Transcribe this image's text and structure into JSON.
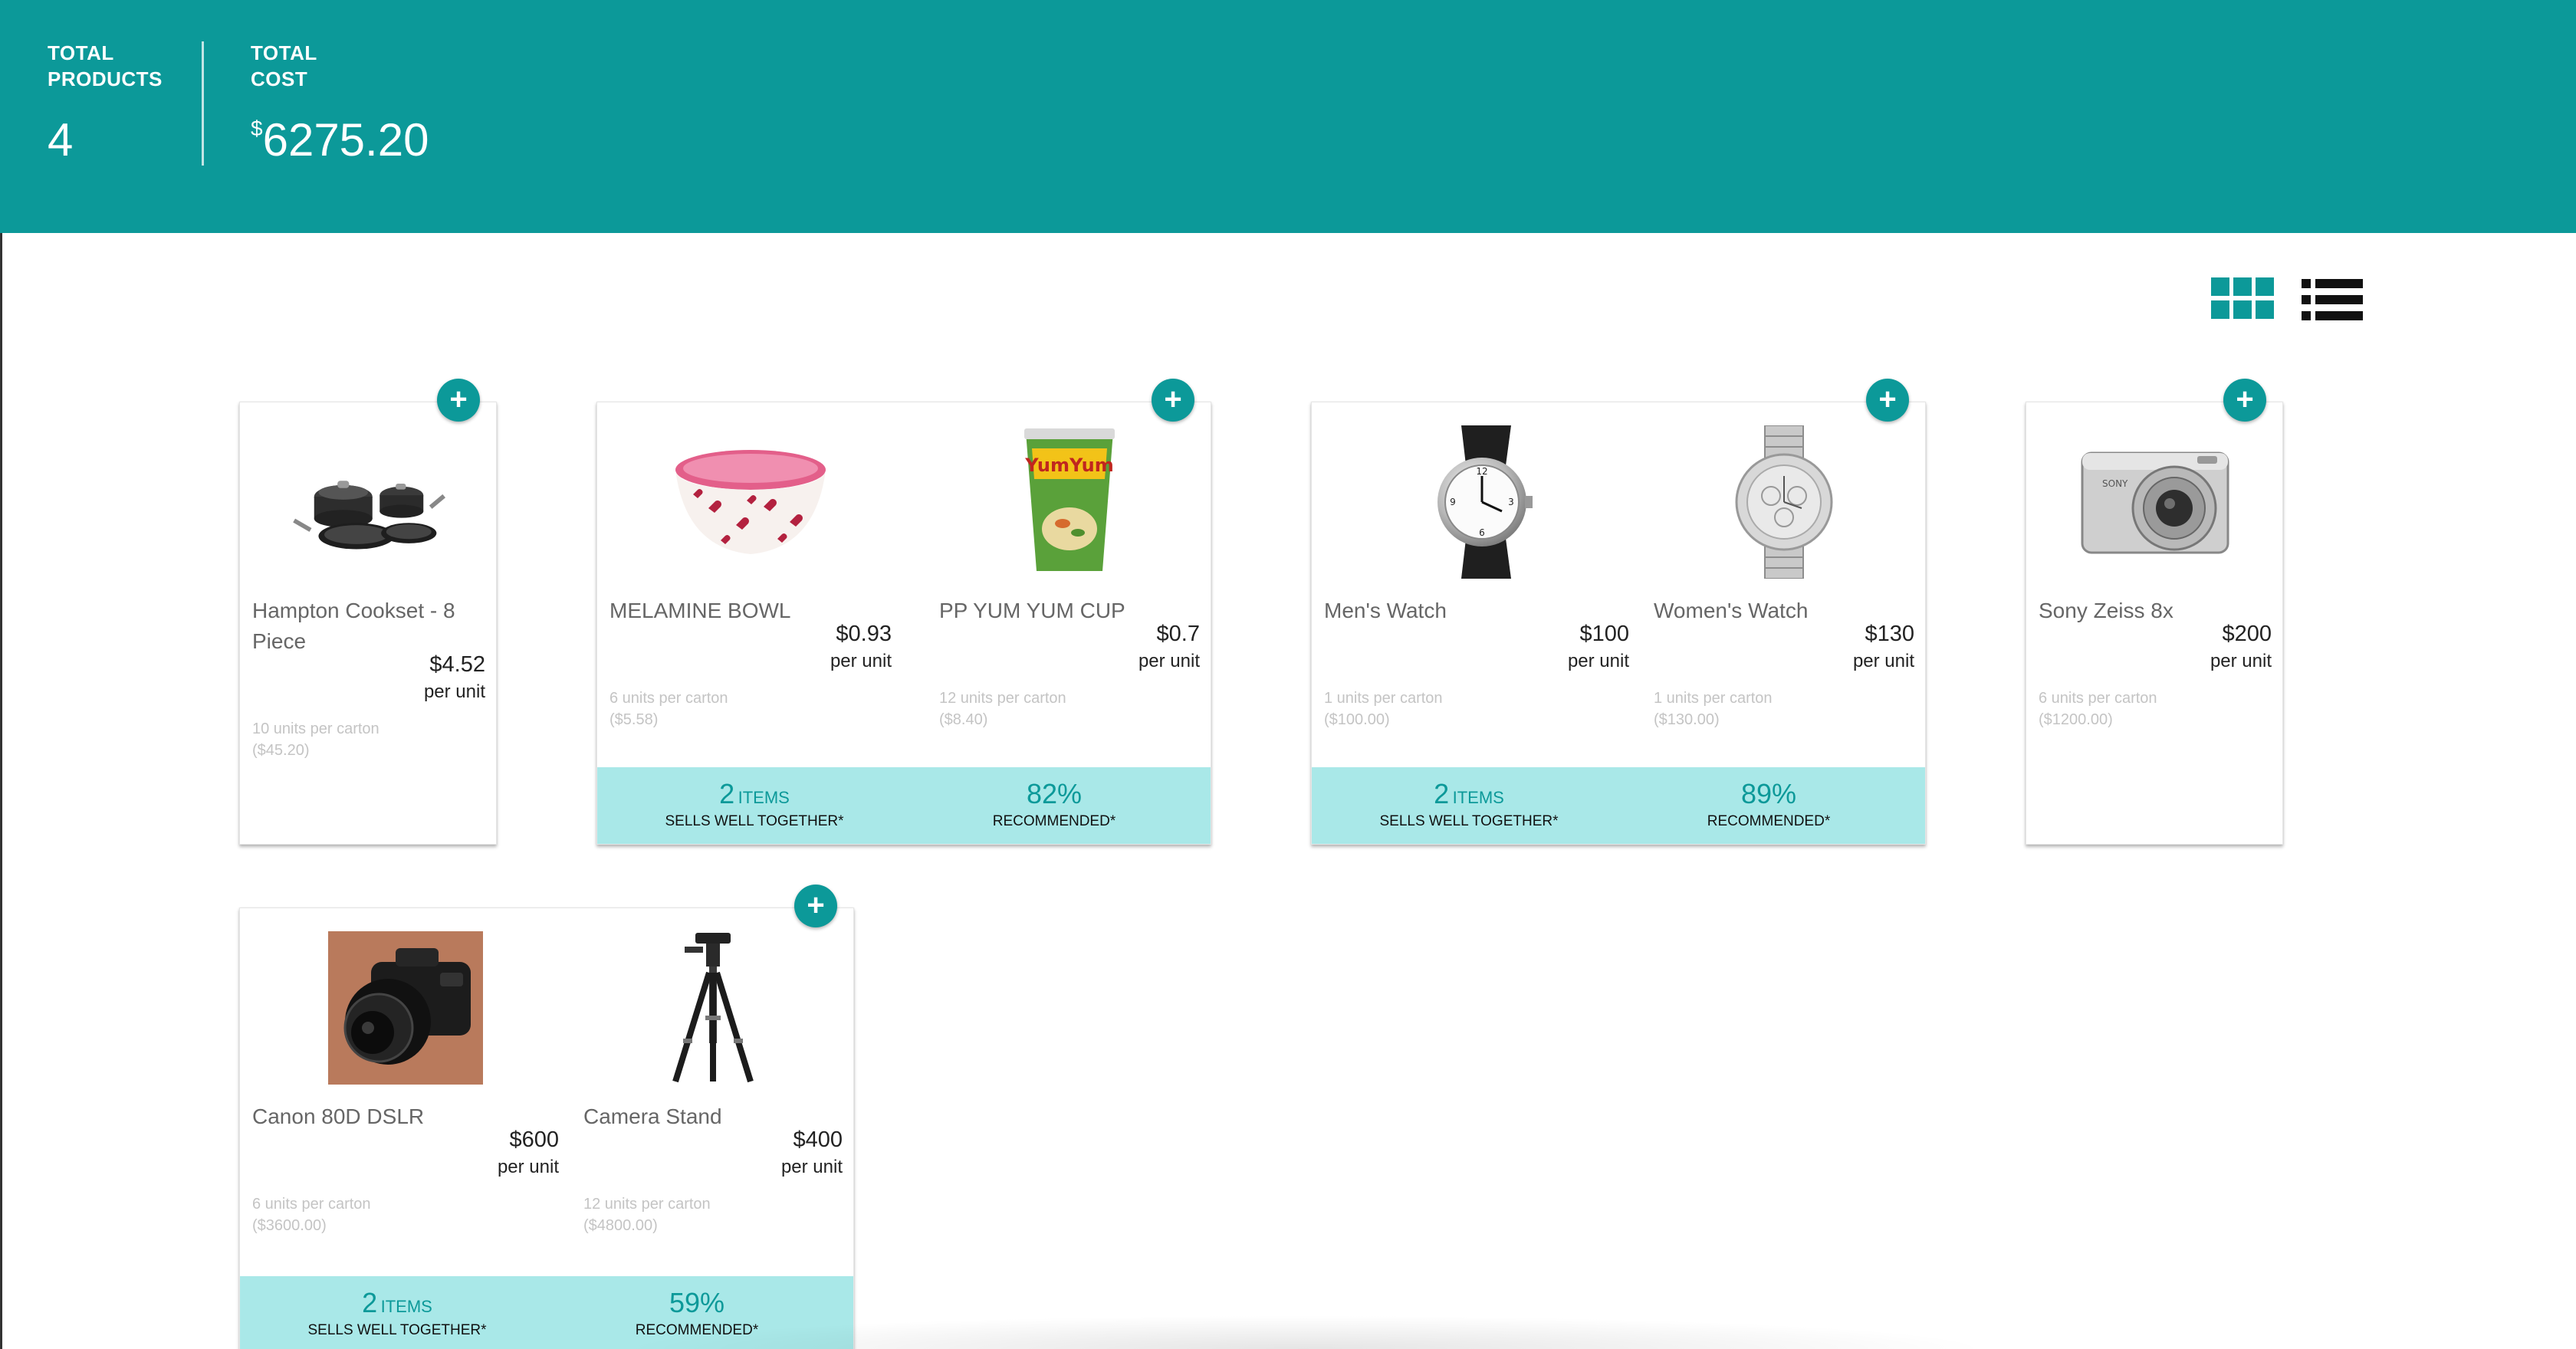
{
  "summary": {
    "total_products": {
      "label_line1": "TOTAL",
      "label_line2": "PRODUCTS",
      "value": "4"
    },
    "total_cost": {
      "label_line1": "TOTAL",
      "label_line2": "COST",
      "currency": "$",
      "value": "6275.20"
    }
  },
  "view_toggles": {
    "grid_icon": "grid-view-icon",
    "list_icon": "list-view-icon",
    "active": "grid"
  },
  "add_button_label": "+",
  "colors": {
    "accent": "#0c9999",
    "strip": "#a9e8e8"
  },
  "groups": [
    {
      "products": [
        {
          "name": "Hampton Cookset - 8 Piece",
          "price": "$4.52",
          "unit": "per unit",
          "carton": "10 units per carton",
          "carton_price": "($45.20)",
          "image": "cookset"
        }
      ]
    },
    {
      "products": [
        {
          "name": "MELAMINE BOWL",
          "price": "$0.93",
          "unit": "per unit",
          "carton": "6 units per carton",
          "carton_price": "($5.58)",
          "image": "bowl"
        },
        {
          "name": "PP YUM YUM CUP",
          "price": "$0.7",
          "unit": "per unit",
          "carton": "12 units per carton",
          "carton_price": "($8.40)",
          "image": "noodle-cup"
        }
      ],
      "strip": {
        "items_count": "2",
        "items_label": "ITEMS",
        "items_caption": "SELLS WELL TOGETHER*",
        "percent": "82%",
        "percent_caption": "RECOMMENDED*"
      }
    },
    {
      "products": [
        {
          "name": "Men's Watch",
          "price": "$100",
          "unit": "per unit",
          "carton": "1 units per carton",
          "carton_price": "($100.00)",
          "image": "mens-watch"
        },
        {
          "name": "Women's Watch",
          "price": "$130",
          "unit": "per unit",
          "carton": "1 units per carton",
          "carton_price": "($130.00)",
          "image": "womens-watch"
        }
      ],
      "strip": {
        "items_count": "2",
        "items_label": "ITEMS",
        "items_caption": "SELLS WELL TOGETHER*",
        "percent": "89%",
        "percent_caption": "RECOMMENDED*"
      }
    },
    {
      "products": [
        {
          "name": "Sony Zeiss 8x",
          "price": "$200",
          "unit": "per unit",
          "carton": "6 units per carton",
          "carton_price": "($1200.00)",
          "image": "camera-compact"
        }
      ]
    },
    {
      "products": [
        {
          "name": "Canon 80D DSLR",
          "price": "$600",
          "unit": "per unit",
          "carton": "6 units per carton",
          "carton_price": "($3600.00)",
          "image": "dslr"
        },
        {
          "name": "Camera Stand",
          "price": "$400",
          "unit": "per unit",
          "carton": "12 units per carton",
          "carton_price": "($4800.00)",
          "image": "tripod"
        }
      ],
      "strip": {
        "items_count": "2",
        "items_label": "ITEMS",
        "items_caption": "SELLS WELL TOGETHER*",
        "percent": "59%",
        "percent_caption": "RECOMMENDED*"
      }
    }
  ]
}
